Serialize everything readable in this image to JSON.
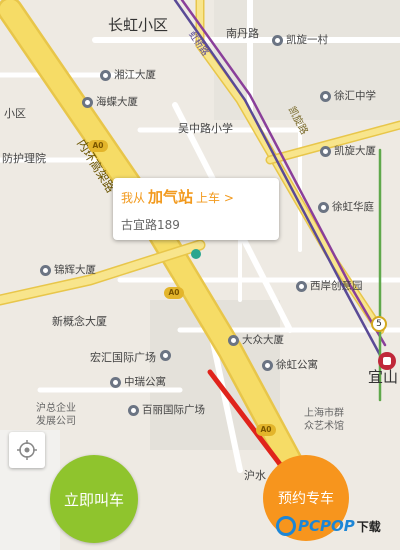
{
  "colors": {
    "map_bg": "#eeeae3",
    "arterial_road": "#f5d75a",
    "minor_road": "#ffffff",
    "metro_line_1": "#8a3f9a",
    "metro_line_2": "#5a4a96",
    "pickup_accent": "#f29a1e",
    "call_now_button": "#8fc42d",
    "reserve_button": "#f7951d",
    "arrow": "#e0231b",
    "watermark": "#1c86d6"
  },
  "map": {
    "labels": {
      "changhong": "长虹小区",
      "nandan_road": "南丹路",
      "kaixuan_yicun": "凯旋一村",
      "xiangjiang": "湘江大厦",
      "haidie": "海蝶大厦",
      "xuhui_zhongxue": "徐汇中学",
      "xiaoqu": "小区",
      "wuzhonglu_school": "吴中路小学",
      "kaixuan_dasha": "凯旋大厦",
      "fengzhi": "防护理院",
      "xuhui_huating": "徐虹华庭",
      "jinhui": "锦辉大厦",
      "xian_jianyuan": "西岸创意园",
      "xingainian": "新概念大厦",
      "dazhong": "大众大厦",
      "honghui": "宏汇国际广场",
      "xuhui_gongyu": "徐虹公寓",
      "zhongrui": "中瑞公寓",
      "hu_qiye": "沪总企业\n发展公司",
      "baili": "百丽国际广场",
      "shanghai_art": "上海市群\n众艺术馆",
      "yishan": "宜山",
      "huchen": "沪水",
      "kaixuan_road": "凯旋路",
      "neihuan": "内环高架路",
      "huxi": "虹桥路"
    },
    "shields": [
      "A0",
      "A0",
      "A0"
    ],
    "metro_stop": "5"
  },
  "pickup_card": {
    "prefix": "我从",
    "place": "加气站",
    "suffix": "上车 >",
    "address": "古宜路189"
  },
  "buttons": {
    "call_now": "立即叫车",
    "reserve": "预约专车"
  },
  "watermark": {
    "text_primary": "PCPOP",
    "text_secondary": "下载"
  }
}
